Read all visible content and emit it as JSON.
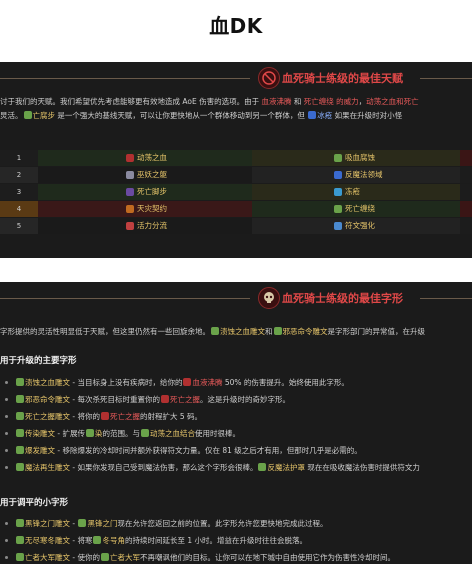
{
  "page": {
    "title": "血DK"
  },
  "panel1": {
    "title": "血死骑士练级的最佳天赋",
    "para_line1": [
      {
        "t": "讨于我们的天赋。我们希望优先考虑能够更有效地造成 AoE 伤害的选项。由于 ",
        "c": "n"
      },
      {
        "t": "血液沸腾",
        "c": "r"
      },
      {
        "t": " 和 ",
        "c": "n"
      },
      {
        "t": "死亡缠绕 的威力",
        "c": "r"
      },
      {
        "t": "，",
        "c": "n"
      },
      {
        "t": "动荡之血和死亡",
        "c": "r"
      }
    ],
    "para_line2": [
      {
        "t": "炅活。",
        "c": "n"
      },
      {
        "t": "亡腐步",
        "c": "g"
      },
      {
        "t": " 是一个强大的基线天赋，可以让你更快地从一个群体移动到另一个群体，但 ",
        "c": "n"
      },
      {
        "t": "冰疮",
        "c": "b"
      },
      {
        "t": " 如果在升级时对小怪",
        "c": "n"
      }
    ],
    "rows": [
      {
        "num": "1",
        "left": "动荡之血",
        "right": "吸血腐蚀"
      },
      {
        "num": "2",
        "left": "巫妖之躯",
        "right": "反魔法领域"
      },
      {
        "num": "3",
        "left": "死亡脚步",
        "right": "冻疮"
      },
      {
        "num": "4",
        "left": "天灾契约",
        "right": "死亡缠绕"
      },
      {
        "num": "5",
        "left": "活力分流",
        "right": "符文强化"
      }
    ]
  },
  "panel2": {
    "title": "血死骑士练级的最佳字形",
    "intro": [
      {
        "t": "字形提供的灵活性明显低于天赋，但这里仍然有一些回旋余地。",
        "c": "n"
      },
      {
        "t": "溃蚀之血雕文",
        "c": "g"
      },
      {
        "t": "和",
        "c": "n"
      },
      {
        "t": "邪恶命令雕文",
        "c": "g"
      },
      {
        "t": "是字形部门的异常值，在升级",
        "c": "n"
      }
    ],
    "major_heading": "用于升级的主要字形",
    "major": [
      [
        {
          "t": "溃蚀之血雕文",
          "c": "g"
        },
        {
          "t": " - 当目标身上没有疾病时，给你的",
          "c": "n"
        },
        {
          "t": "血液沸腾",
          "c": "r"
        },
        {
          "t": " 50% 的伤害提升。始终使用此字形。",
          "c": "n"
        }
      ],
      [
        {
          "t": "邪恶命令雕文",
          "c": "g"
        },
        {
          "t": " - 每次杀死目标时重置你的",
          "c": "n"
        },
        {
          "t": "死亡之握",
          "c": "r"
        },
        {
          "t": "。这是升级时的奇妙字形。",
          "c": "n"
        }
      ],
      [
        {
          "t": "死亡之握雕文",
          "c": "g"
        },
        {
          "t": " - 将你的",
          "c": "n"
        },
        {
          "t": "死亡之握",
          "c": "r"
        },
        {
          "t": "的射程扩大 5 码。",
          "c": "n"
        }
      ],
      [
        {
          "t": "传染雕文",
          "c": "g"
        },
        {
          "t": " - 扩展传",
          "c": "n"
        },
        {
          "t": "染",
          "c": "g"
        },
        {
          "t": "的范围。与",
          "c": "n"
        },
        {
          "t": "动荡之血结合",
          "c": "g"
        },
        {
          "t": "使用时很棒。",
          "c": "n"
        }
      ],
      [
        {
          "t": "爆发雕文",
          "c": "g"
        },
        {
          "t": " - 移除爆发的",
          "c": "n"
        },
        {
          "t": "冷却时间并额外获得符文力量。仅在 81 级之后才有用，但那时几乎是必需的。",
          "c": "n"
        }
      ],
      [
        {
          "t": "魔法再生雕文",
          "c": "g"
        },
        {
          "t": " - 如果你发现自己受到魔法伤害，那么这个字形会很棒。",
          "c": "n"
        },
        {
          "t": "反魔法护罩",
          "c": "g"
        },
        {
          "t": " 现在在吸收魔法伤害时提供符文力",
          "c": "n"
        }
      ]
    ],
    "minor_heading": "用于调平的小字形",
    "minor": [
      [
        {
          "t": "黑锋之门雕文",
          "c": "g"
        },
        {
          "t": " - ",
          "c": "n"
        },
        {
          "t": "黑锋之门",
          "c": "g"
        },
        {
          "t": "现在允许您返回之前的位置。此字形允许您更快地完成此过程。",
          "c": "n"
        }
      ],
      [
        {
          "t": "无尽寒冬雕文",
          "c": "g"
        },
        {
          "t": " - 将寒",
          "c": "n"
        },
        {
          "t": "冬号角",
          "c": "g"
        },
        {
          "t": "的持续时间延长至 1 小时。增益在升级时往往会脱落。",
          "c": "n"
        }
      ],
      [
        {
          "t": "亡者大军雕文",
          "c": "g"
        },
        {
          "t": " - 使你的",
          "c": "n"
        },
        {
          "t": "亡者大军",
          "c": "g"
        },
        {
          "t": "不再嘲讽他们的目标。让你可以在地下城中自由使用它作为伤害性冷却时间。",
          "c": "n"
        }
      ]
    ]
  },
  "colors": {
    "panel_bg": "#1b1b1b",
    "title_red": "#e04848",
    "gold": "#e6c56a",
    "red_link": "#e85a5a",
    "blue_link": "#8ab0ff"
  },
  "icons": {
    "emblem": "skull-emblem-icon",
    "spell": "spell-icon",
    "bullet": "bullet-dot-icon"
  }
}
